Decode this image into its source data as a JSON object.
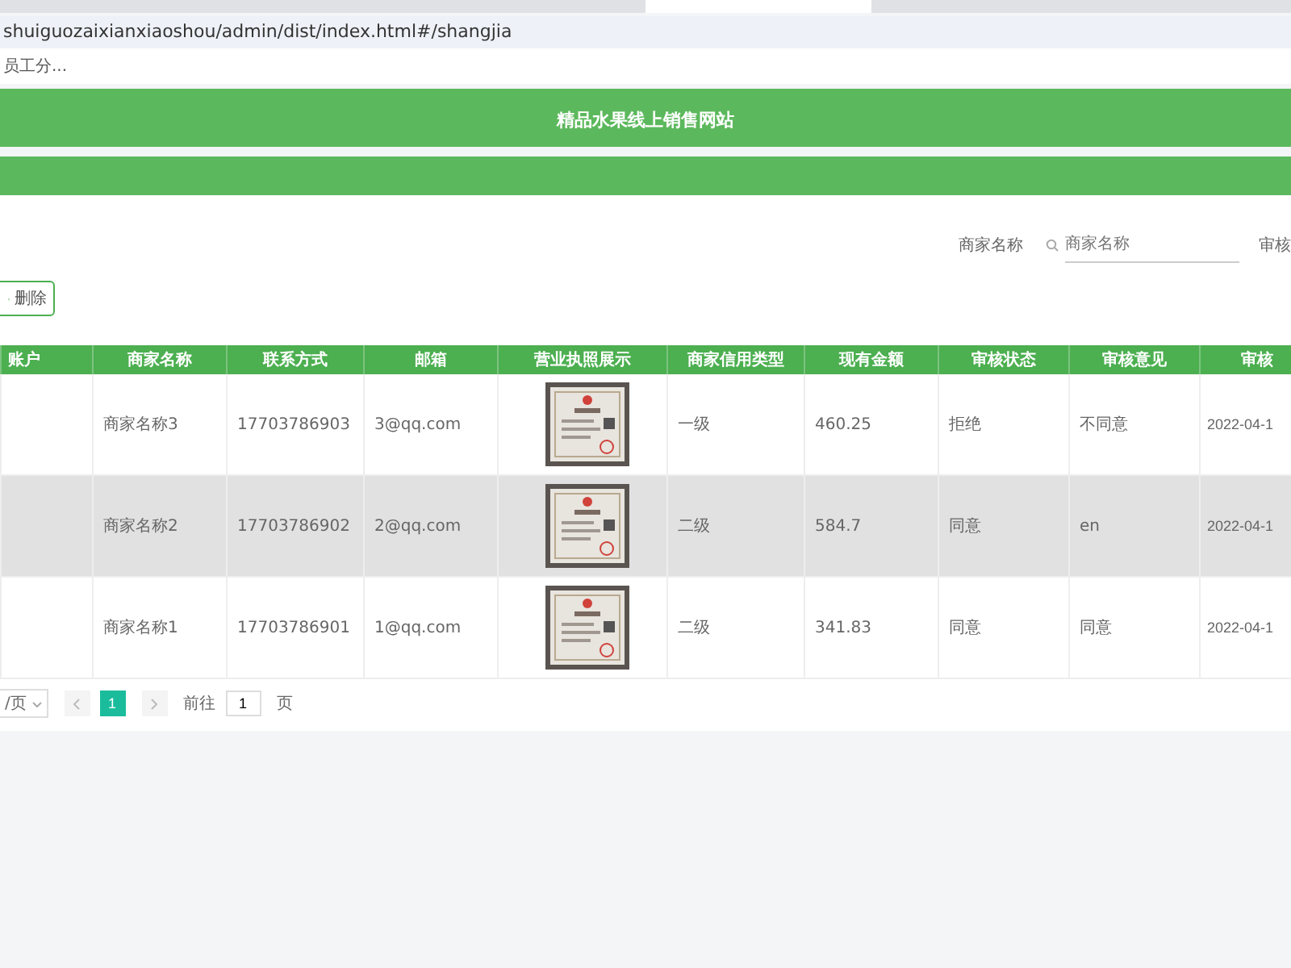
{
  "browser": {
    "url": "shuiguozaixianxiaoshou/admin/dist/index.html#/shangjia",
    "bookmark": "员工分..."
  },
  "header": {
    "title": "精品水果线上销售网站"
  },
  "search": {
    "label": "商家名称",
    "placeholder": "商家名称",
    "next_label": "审核"
  },
  "toolbar": {
    "delete_label": "删除"
  },
  "table": {
    "columns": [
      "账户",
      "商家名称",
      "联系方式",
      "邮箱",
      "营业执照展示",
      "商家信用类型",
      "现有金额",
      "审核状态",
      "审核意见",
      "审核"
    ],
    "rows": [
      {
        "highlighted": false,
        "cells": [
          "",
          "商家名称3",
          "17703786903",
          "3@qq.com",
          {
            "kind": "picture"
          },
          "一级",
          "460.25",
          "拒绝",
          "不同意",
          "2022-04-1"
        ]
      },
      {
        "highlighted": true,
        "cells": [
          "",
          "商家名称2",
          "17703786902",
          "2@qq.com",
          {
            "kind": "picture"
          },
          "二级",
          "584.7",
          "同意",
          "en",
          "2022-04-1"
        ]
      },
      {
        "highlighted": false,
        "cells": [
          "",
          "商家名称1",
          "17703786901",
          "1@qq.com",
          {
            "kind": "picture"
          },
          "二级",
          "341.83",
          "同意",
          "同意",
          "2022-04-1"
        ]
      }
    ]
  },
  "pagination": {
    "page_size": "/页",
    "pages": [
      {
        "label": "1",
        "selected": true
      }
    ],
    "goto_label": "前往",
    "goto_value": "1",
    "goto_suffix": "页"
  }
}
